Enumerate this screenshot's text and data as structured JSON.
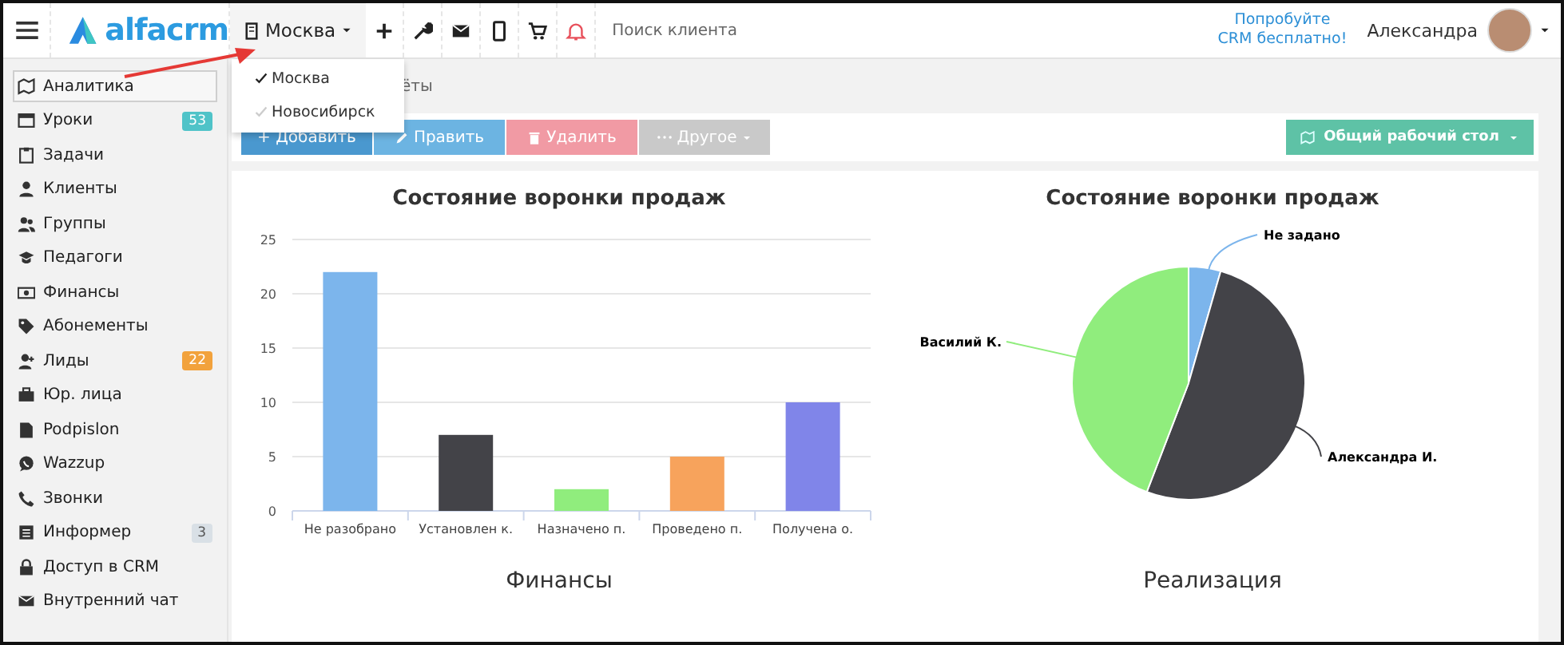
{
  "header": {
    "logo": "alfacrm",
    "city": "Москва",
    "search": {
      "placeholder": "Поиск клиента"
    },
    "promo": "Попробуйте CRM бесплатно!",
    "user": "Александра"
  },
  "city_menu": [
    {
      "label": "Москва",
      "selected": true
    },
    {
      "label": "Новосибирск",
      "selected": false
    }
  ],
  "sidebar": {
    "items": [
      {
        "label": "Аналитика",
        "selected": true
      },
      {
        "label": "Уроки",
        "selected": false,
        "badge": "53",
        "color": "#4fc3c8"
      },
      {
        "label": "Задачи",
        "selected": false
      },
      {
        "label": "Клиенты",
        "selected": false
      },
      {
        "label": "Группы",
        "selected": false
      },
      {
        "label": "Педагоги",
        "selected": false
      },
      {
        "label": "Финансы",
        "selected": false
      },
      {
        "label": "Абонементы",
        "selected": false
      },
      {
        "label": "Лиды",
        "selected": false,
        "badge": "22",
        "color": "#f2a23c"
      },
      {
        "label": "Юр. лица",
        "selected": false
      },
      {
        "label": "Podpislon",
        "selected": false
      },
      {
        "label": "Wazzup",
        "selected": false
      },
      {
        "label": "Звонки",
        "selected": false
      },
      {
        "label": "Информер",
        "selected": false,
        "badge": "3",
        "color": "#d9e0e6"
      },
      {
        "label": "Доступ в CRM",
        "selected": false
      },
      {
        "label": "Внутренний чат",
        "selected": false
      }
    ]
  },
  "breadcrumb": "ёты",
  "toolbar": {
    "buttons": [
      {
        "label": "+ Добавить",
        "kind": "plain",
        "color": "#4a98cf"
      },
      {
        "label": "Править",
        "kind": "pencil",
        "color": "#6cb4e2"
      },
      {
        "label": "Удалить",
        "kind": "trash",
        "color": "#f19aa4"
      },
      {
        "label": "Другое",
        "kind": "more",
        "color": "#c9c9c9"
      }
    ],
    "workspace": "Общий рабочий стол"
  },
  "sales_funnel": {
    "title": "Состояние воронки продаж",
    "chart_data": {
      "type": "bar",
      "categories": [
        "Не разобрано",
        "Установлен к.",
        "Назначено п.",
        "Проведено п.",
        "Получена о."
      ],
      "values": [
        22,
        7,
        2,
        5,
        10
      ],
      "colors": [
        "#7cb5ec",
        "#434348",
        "#90ed7d",
        "#f7a35c",
        "#8085e9"
      ],
      "ylim": [
        0,
        25
      ],
      "yticks": [
        0,
        5,
        10,
        15,
        20,
        25
      ],
      "grid": true
    }
  },
  "sales_by_manager": {
    "title": "Состояние воронки продаж",
    "slices": [
      {
        "label": "Не задано",
        "color": "#7cb5ec"
      },
      {
        "label": "Александра И.",
        "color": "#434348"
      },
      {
        "label": "Василий К.",
        "color": "#90ed7d"
      }
    ]
  },
  "lower_titles": [
    "Финансы",
    "Реализация"
  ]
}
